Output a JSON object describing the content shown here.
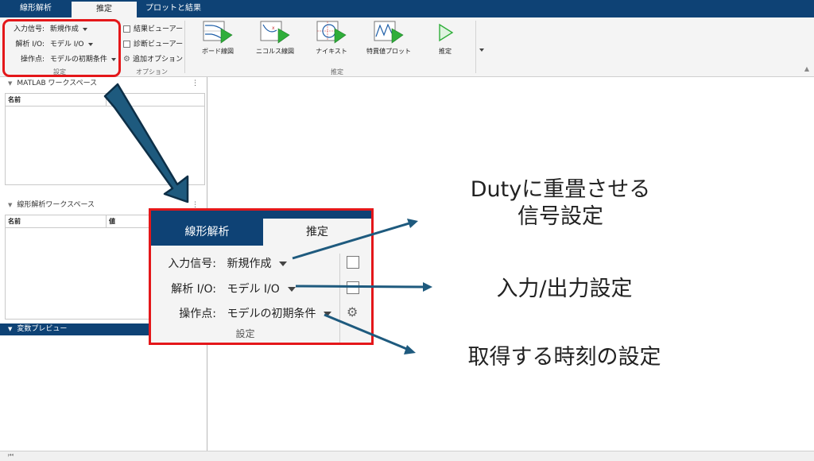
{
  "tabs": [
    {
      "label": "線形解析"
    },
    {
      "label": "推定"
    },
    {
      "label": "プロットと結果"
    }
  ],
  "settings": {
    "input_signal_label": "入力信号:",
    "input_signal_value": "新規作成",
    "analysis_io_label": "解析 I/O:",
    "analysis_io_value": "モデル I/O",
    "operating_point_label": "操作点:",
    "operating_point_value": "モデルの初期条件",
    "section_label": "設定"
  },
  "options": {
    "result_viewer": "結果ビューアー",
    "diagnostic_viewer": "診断ビューアー",
    "additional_options": "追加オプション",
    "section_label": "オプション"
  },
  "estimate": {
    "buttons": [
      {
        "label": "ボード線図",
        "icon": "bode-plot-icon"
      },
      {
        "label": "ニコルス線図",
        "icon": "nichols-plot-icon"
      },
      {
        "label": "ナイキスト",
        "icon": "nyquist-plot-icon"
      },
      {
        "label": "特異値プロット",
        "icon": "singular-value-plot-icon"
      },
      {
        "label": "推定",
        "icon": "run-icon"
      }
    ],
    "section_label": "推定"
  },
  "panels": {
    "matlab_workspace": {
      "title": "MATLAB ワークスペース",
      "col_name": "名前"
    },
    "linear_workspace": {
      "title": "線形解析ワークスペース",
      "col_name": "名前",
      "col_value": "値"
    },
    "variable_preview": {
      "title": "変数プレビュー"
    }
  },
  "zoom": {
    "tab_linear": "線形解析",
    "tab_estimate": "推定",
    "input_signal_label": "入力信号:",
    "input_signal_value": "新規作成",
    "analysis_io_label": "解析 I/O:",
    "analysis_io_value": "モデル I/O",
    "operating_point_label": "操作点:",
    "operating_point_value": "モデルの初期条件",
    "section_label": "設定"
  },
  "annotations": {
    "note1_line1": "Dutyに重畳させる",
    "note1_line2": "信号設定",
    "note2": "入力/出力設定",
    "note3": "取得する時刻の設定"
  },
  "colors": {
    "brand_blue": "#0e4275",
    "highlight_red": "#e4171a",
    "arrow_blue": "#1e5a7e",
    "play_green": "#2fae3a"
  }
}
